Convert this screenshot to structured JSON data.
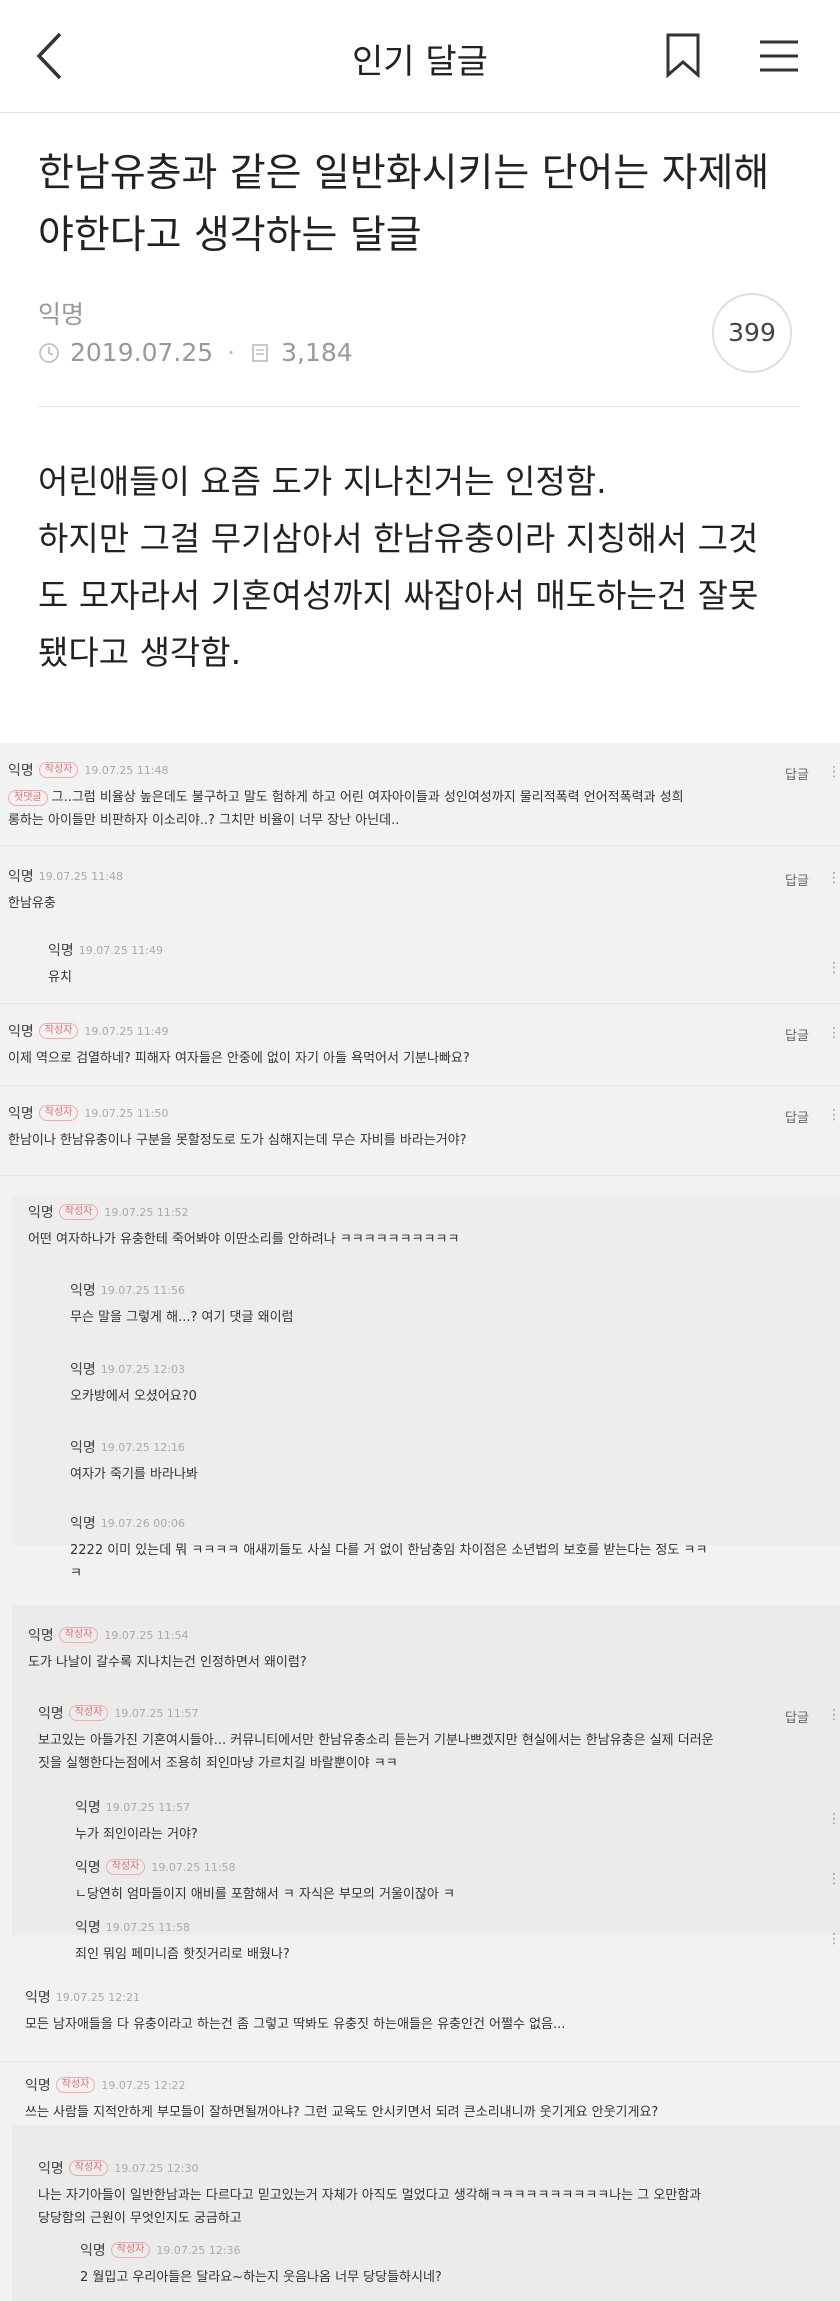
{
  "header": {
    "title": "인기 달글",
    "back_icon": "back-chevron-icon",
    "bookmark_icon": "bookmark-icon",
    "menu_icon": "hamburger-menu-icon"
  },
  "post": {
    "title_line1": "한남유충과 같은 일반화시키는 단어는 자제해",
    "title_line2": "야한다고 생각하는 달글",
    "author": "익명",
    "date": "2019.07.25",
    "views": "3,184",
    "comment_count": "399",
    "body": [
      "어린애들이 요즘 도가 지나친거는 인정함.",
      "하지만 그걸 무기삼아서 한남유충이라 지칭해서 그것",
      "도 모자라서 기혼여성까지 싸잡아서 매도하는건 잘못",
      "됐다고 생각함."
    ]
  },
  "labels": {
    "reply": "답글",
    "author_badge": "작성자",
    "ellipsis": "⋮",
    "deleted_badge": "첫댓글"
  },
  "comments": [
    {
      "name": "익명",
      "badge": true,
      "time": "19.07.25 11:48",
      "lines": [
        "그..그럼 비율상 높은데도 불구하고 말도 험하게 하고 어린 여자아이들과 성인여성까지 물리적폭력 언어적폭력과 성희",
        "롱하는 아이들만 비판하자 이소리야..? 그치만 비율이 너무 장난 아닌데.."
      ]
    },
    {
      "name": "익명",
      "badge": false,
      "time": "19.07.25 11:48",
      "lines": [
        "한남유충"
      ]
    },
    {
      "name": "익명",
      "badge": false,
      "time": "19.07.25 11:49",
      "lines": [
        "유치"
      ]
    },
    {
      "name": "익명",
      "badge": true,
      "time": "19.07.25 11:49",
      "lines": [
        "이제 역으로 검열하네? 피해자 여자들은 안중에 없이 자기 아들 욕먹어서 기분나빠요?"
      ]
    },
    {
      "name": "익명",
      "badge": true,
      "time": "19.07.25 11:50",
      "lines": [
        "한남이나 한남유충이나 구분을 못할정도로 도가 심해지는데 무슨 자비를 바라는거야?"
      ]
    },
    {
      "name": "익명",
      "badge": true,
      "time": "19.07.25 11:52",
      "lines": [
        "어떤 여자하나가 유충한테 죽어봐야 이딴소리를 안하려나 ㅋㅋㅋㅋㅋㅋㅋㅋㅋㅋ"
      ]
    },
    {
      "name": "익명",
      "badge": false,
      "time": "19.07.25 11:56",
      "lines": [
        "무슨 말을 그렇게 해...? 여기 댓글 왜이럼"
      ]
    },
    {
      "name": "익명",
      "badge": false,
      "time": "19.07.25 12:03",
      "lines": [
        "오카방에서 오셨어요?0"
      ]
    },
    {
      "name": "익명",
      "badge": false,
      "time": "19.07.25 12:16",
      "lines": [
        "여자가 죽기를 바라나봐"
      ]
    },
    {
      "name": "익명",
      "badge": false,
      "time": "19.07.26 00:06",
      "lines": [
        "2222 이미 있는데 뭐 ㅋㅋㅋㅋ 애새끼들도 사실 다를 거 없이 한남충임 차이점은 소년법의 보호를 받는다는 정도 ㅋㅋ",
        "ㅋ"
      ]
    },
    {
      "name": "익명",
      "badge": true,
      "time": "19.07.25 11:54",
      "lines": [
        "도가 나날이 갈수록 지나치는건 인정하면서 왜이럼?"
      ]
    },
    {
      "name": "익명",
      "badge": true,
      "time": "19.07.25 11:57",
      "lines": [
        "보고있는 아들가진 기혼여시들아... 커뮤니티에서만 한남유충소리 듣는거 기분나쁘겠지만 현실에서는 한남유충은 실제 더러운",
        "짓을 실행한다는점에서 조용히 죄인마냥 가르치길 바랄뿐이야 ㅋㅋ"
      ]
    },
    {
      "name": "익명",
      "badge": false,
      "time": "19.07.25 11:57",
      "lines": [
        "누가 죄인이라는 거야?"
      ]
    },
    {
      "name": "익명",
      "badge": true,
      "time": "19.07.25 11:58",
      "lines": [
        "ㄴ당연히 엄마들이지 애비를 포함해서 ㅋ 자식은 부모의 거울이잖아 ㅋ"
      ]
    },
    {
      "name": "익명",
      "badge": false,
      "time": "19.07.25 11:58",
      "lines": [
        "죄인 뭐임 페미니즘 핫짓거리로 배웠나?"
      ]
    },
    {
      "name": "익명",
      "badge": false,
      "time": "19.07.25 12:21",
      "lines": [
        "모든 남자애들을 다 유충이라고 하는건 좀 그렇고 딱봐도 유충짓 하는애들은 유충인건 어쩔수 없음..."
      ]
    },
    {
      "name": "익명",
      "badge": true,
      "time": "19.07.25 12:22",
      "lines": [
        "쓰는 사람들 지적안하게 부모들이 잘하면될꺼아냐? 그런 교육도 안시키면서 되려 큰소리내니까 웃기게요 안웃기게요?"
      ]
    },
    {
      "name": "익명",
      "badge": true,
      "time": "19.07.25 12:30",
      "lines": [
        "나는 자기아들이 일반한남과는 다르다고 믿고있는거 자체가 아직도 멀었다고 생각해ㅋㅋㅋㅋㅋㅋㅋㅋㅋㅋ나는 그 오만함과",
        "당당함의 근원이 무엇인지도 궁금하고"
      ]
    },
    {
      "name": "익명",
      "badge": true,
      "time": "19.07.25 12:36",
      "lines": [
        "2 월밉고 우리아들은 달라요~하는지 웃음나옴 너무 당당들하시네?"
      ]
    }
  ]
}
